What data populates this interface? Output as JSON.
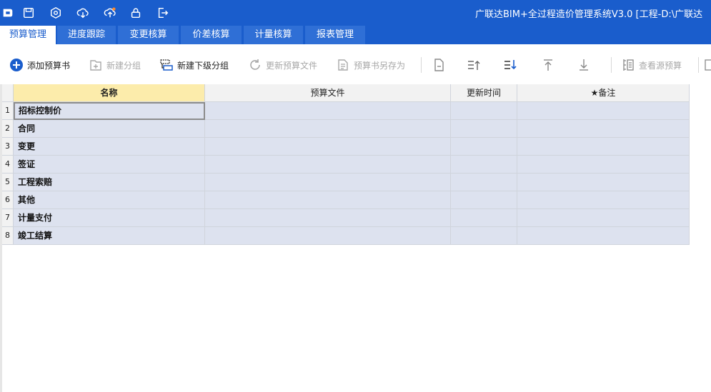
{
  "app": {
    "title": "广联达BIM+全过程造价管理系统V3.0 [工程-D:\\广联达"
  },
  "quick_access": [
    {
      "name": "app-logo-icon"
    },
    {
      "name": "save-icon"
    },
    {
      "name": "settings-icon"
    },
    {
      "name": "cloud-download-icon"
    },
    {
      "name": "cloud-upload-icon"
    },
    {
      "name": "lock-icon"
    },
    {
      "name": "exit-icon"
    }
  ],
  "tabs": [
    {
      "label": "预算管理",
      "active": true
    },
    {
      "label": "进度跟踪",
      "active": false
    },
    {
      "label": "变更核算",
      "active": false
    },
    {
      "label": "价差核算",
      "active": false
    },
    {
      "label": "计量核算",
      "active": false
    },
    {
      "label": "报表管理",
      "active": false
    }
  ],
  "toolbar": {
    "add_budget": "添加预算书",
    "new_group": "新建分组",
    "new_subgroup": "新建下级分组",
    "update_budget_file": "更新预算文件",
    "save_budget_as": "预算书另存为",
    "view_source_budget": "查看源预算"
  },
  "grid": {
    "headers": [
      "名称",
      "预算文件",
      "更新时间",
      "★备注"
    ],
    "rows": [
      {
        "num": "1",
        "name": "招标控制价",
        "file": "",
        "time": "",
        "note": ""
      },
      {
        "num": "2",
        "name": "合同",
        "file": "",
        "time": "",
        "note": ""
      },
      {
        "num": "3",
        "name": "变更",
        "file": "",
        "time": "",
        "note": ""
      },
      {
        "num": "4",
        "name": "签证",
        "file": "",
        "time": "",
        "note": ""
      },
      {
        "num": "5",
        "name": "工程索赔",
        "file": "",
        "time": "",
        "note": ""
      },
      {
        "num": "6",
        "name": "其他",
        "file": "",
        "time": "",
        "note": ""
      },
      {
        "num": "7",
        "name": "计量支付",
        "file": "",
        "time": "",
        "note": ""
      },
      {
        "num": "8",
        "name": "竣工结算",
        "file": "",
        "time": "",
        "note": ""
      }
    ]
  },
  "colors": {
    "brand_blue": "#1a5dcc",
    "selected_header": "#fcecab",
    "row_fill": "#dde2ef"
  }
}
